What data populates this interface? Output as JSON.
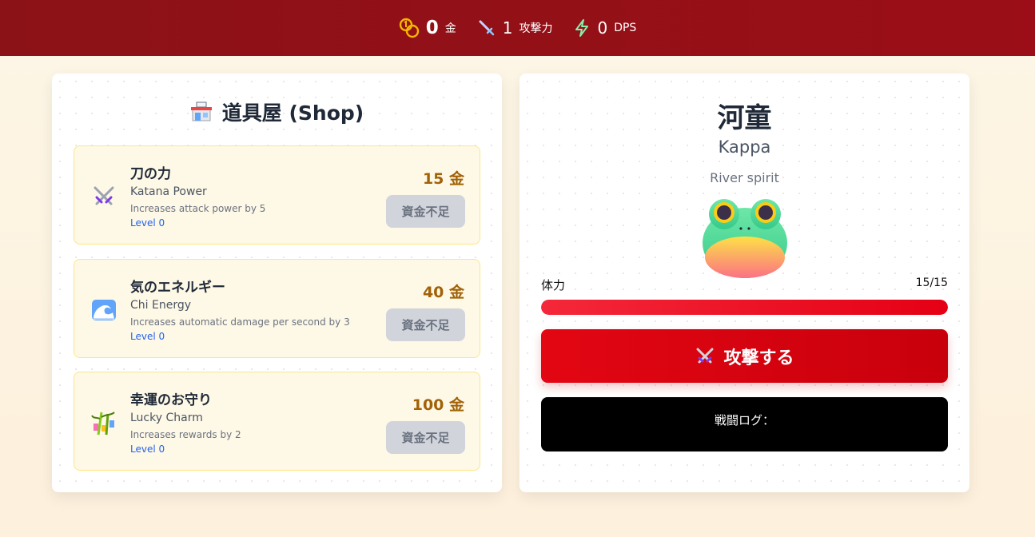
{
  "stats": {
    "gold_value": "0",
    "gold_label": "金",
    "attack_value": "1",
    "attack_label": "攻撃力",
    "dps_value": "0",
    "dps_label": "DPS"
  },
  "shop": {
    "title": "道具屋 (Shop)",
    "items": [
      {
        "name": "刀の力",
        "english": "Katana Power",
        "description": "Increases attack power by 5",
        "level": "Level 0",
        "price": "15 金",
        "button": "資金不足",
        "icon": "crossed-swords-icon"
      },
      {
        "name": "気のエネルギー",
        "english": "Chi Energy",
        "description": "Increases automatic damage per second by 3",
        "level": "Level 0",
        "price": "40 金",
        "button": "資金不足",
        "icon": "wave-icon"
      },
      {
        "name": "幸運のお守り",
        "english": "Lucky Charm",
        "description": "Increases rewards by 2",
        "level": "Level 0",
        "price": "100 金",
        "button": "資金不足",
        "icon": "tanabata-tree-icon"
      }
    ]
  },
  "enemy": {
    "name": "河童",
    "english": "Kappa",
    "subtitle": "River spirit",
    "hp_label": "体力",
    "hp_value": "15/15",
    "hp_fraction": 1.0,
    "icon": "frog-icon"
  },
  "attack_button": "攻撃する",
  "battle_log": {
    "title": "戦闘ログ："
  },
  "colors": {
    "header": "#8b1217",
    "attack": "#e30613",
    "price": "#a16207",
    "level": "#2563eb"
  }
}
